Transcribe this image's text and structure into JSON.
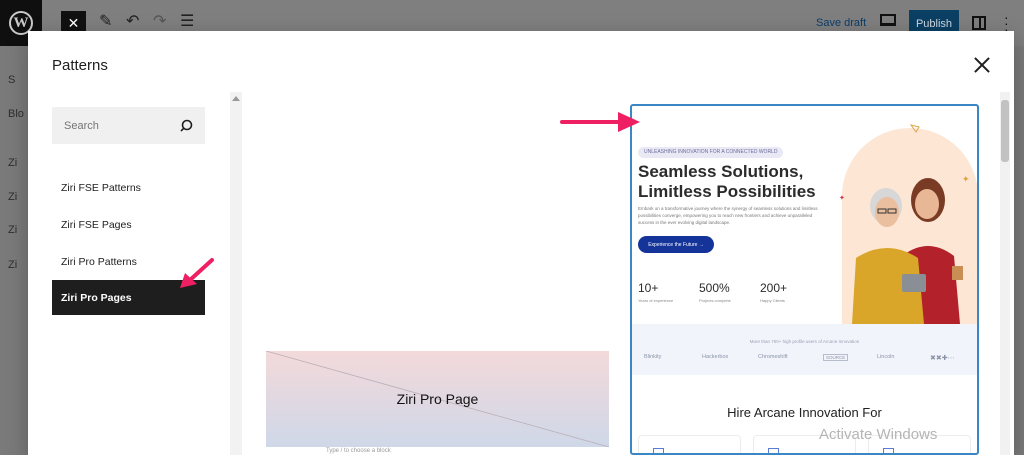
{
  "editor": {
    "save_draft": "Save draft",
    "publish": "Publish",
    "left_ghost": [
      "S",
      "Blo",
      "Zi",
      "Zi",
      "Zi",
      "Zi"
    ]
  },
  "modal": {
    "title": "Patterns",
    "search": {
      "placeholder": "Search"
    },
    "categories": [
      {
        "label": "Ziri FSE Patterns",
        "active": false
      },
      {
        "label": "Ziri FSE Pages",
        "active": false
      },
      {
        "label": "Ziri Pro Patterns",
        "active": false
      },
      {
        "label": "Ziri Pro Pages",
        "active": true
      }
    ],
    "cards": {
      "placeholder": {
        "title": "Ziri Pro Page",
        "hint": "Type / to choose a block"
      },
      "preview": {
        "badge": "UNLEASHING INNOVATION FOR A CONNECTED WORLD",
        "heading": "Seamless Solutions, Limitless Possibilities",
        "body": "Embark on a transformative journey where the synergy of seamless solutions and limitless possibilities converge, empowering you to reach new frontiers and achieve unparalleled success in the ever evolving digital landscape.",
        "cta": "Experience the Future →",
        "stats": [
          {
            "value": "10+",
            "label": "Years of experience"
          },
          {
            "value": "500%",
            "label": "Projects complete"
          },
          {
            "value": "200+",
            "label": "Happy Clients"
          }
        ],
        "logos_caption": "More than 750+ high profile users of Arcane Innovation",
        "logos": [
          "Blinkity",
          "Hackerbox",
          "Chromeshift",
          "SOURCE",
          "Lincoln",
          "✖✖✚⋯"
        ],
        "section_title": "Hire Arcane Innovation For"
      }
    }
  },
  "watermark": "Activate Windows",
  "colors": {
    "accent": "#3b86c4",
    "publish": "#0b3f63",
    "arrow": "#ee1f63",
    "cta": "#15349a"
  }
}
